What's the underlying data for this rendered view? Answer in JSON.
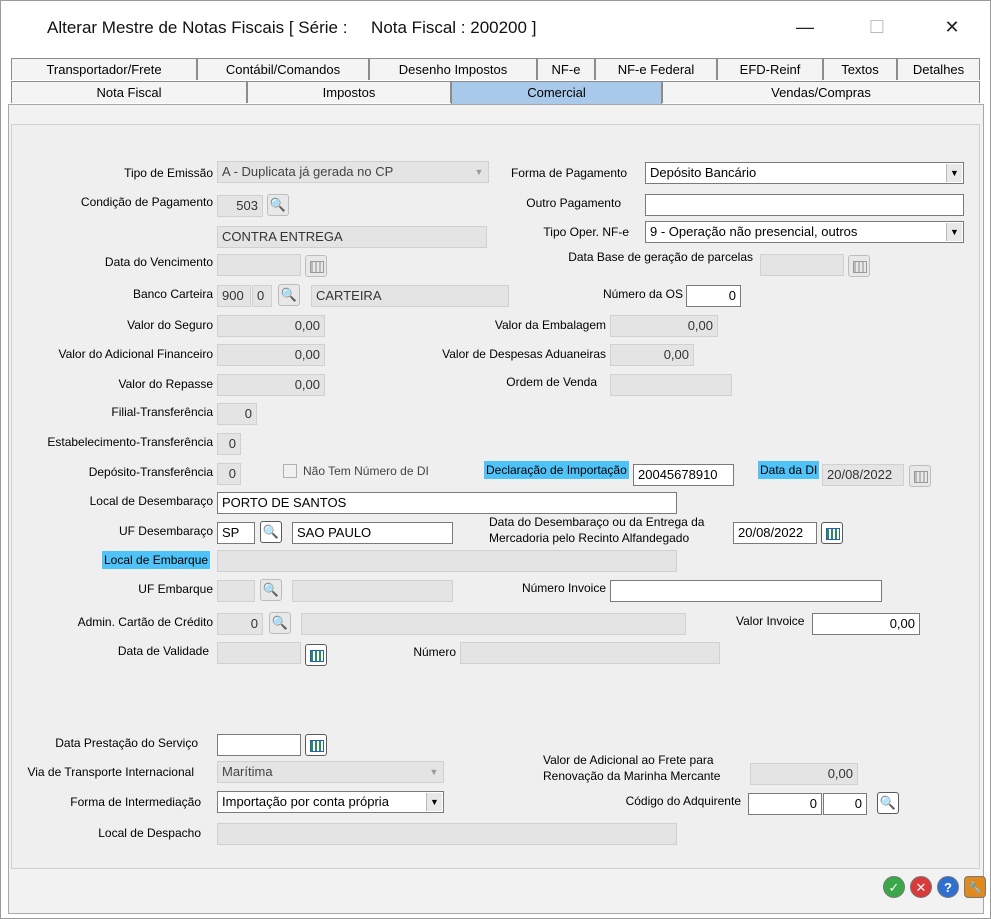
{
  "window": {
    "title": "Alterar Mestre de Notas Fiscais [ Série :     Nota Fiscal : 200200 ]",
    "minimize": "—",
    "maximize": "☐",
    "close": "✕"
  },
  "tabs_top": [
    "Transportador/Frete",
    "Contábil/Comandos",
    "Desenho Impostos",
    "NF-e",
    "NF-e Federal",
    "EFD-Reinf",
    "Textos",
    "Detalhes"
  ],
  "tabs_bottom": [
    "Nota Fiscal",
    "Impostos",
    "Comercial",
    "Vendas/Compras"
  ],
  "active_tab": "Comercial",
  "labels": {
    "tipo_emissao": "Tipo de Emissão",
    "forma_pagamento": "Forma de Pagamento",
    "condicao_pagamento": "Condição de Pagamento",
    "outro_pagamento": "Outro Pagamento",
    "tipo_oper": "Tipo Oper. NF-e",
    "data_vencimento": "Data do Vencimento",
    "data_base": "Data Base de geração de parcelas",
    "banco_carteira": "Banco Carteira",
    "numero_os": "Número da OS",
    "valor_seguro": "Valor do Seguro",
    "valor_embalagem": "Valor da Embalagem",
    "valor_adicional": "Valor do Adicional Financeiro",
    "valor_despesas": "Valor de Despesas Aduaneiras",
    "valor_repasse": "Valor do Repasse",
    "ordem_venda": "Ordem de Venda",
    "filial_transf": "Filial-Transferência",
    "estab_transf": "Estabelecimento-Transferência",
    "deposito_transf": "Depósito-Transferência",
    "nao_tem_di": "Não Tem Número de DI",
    "declaracao_importacao": "Declaração de Importação",
    "data_di": "Data da DI",
    "local_desembaraco": "Local de Desembaraço",
    "uf_desembaraco": "UF Desembaraço",
    "data_desembaraco_1": "Data do Desembaraço ou da Entrega da",
    "data_desembaraco_2": "Mercadoria pelo Recinto Alfandegado",
    "local_embarque": "Local de Embarque",
    "uf_embarque": "UF Embarque",
    "numero_invoice": "Número Invoice",
    "admin_cartao": "Admin. Cartão de Crédito",
    "valor_invoice": "Valor Invoice",
    "data_validade": "Data de Validade",
    "numero": "Número",
    "data_prestacao": "Data Prestação do Serviço",
    "via_transporte": "Via de Transporte Internacional",
    "valor_adicional_frete_1": "Valor de Adicional ao Frete para",
    "valor_adicional_frete_2": "Renovação da Marinha Mercante",
    "forma_intermediacao": "Forma de Intermediação",
    "codigo_adquirente": "Código do Adquirente",
    "local_despacho": "Local de Despacho"
  },
  "values": {
    "tipo_emissao": "A - Duplicata já gerada no CP",
    "forma_pagamento": "Depósito Bancário",
    "condicao_pagamento_code": "503",
    "condicao_pagamento_desc": "CONTRA ENTREGA",
    "outro_pagamento": "",
    "tipo_oper": "9 - Operação não presencial, outros",
    "data_vencimento": "",
    "data_base": "",
    "banco": "900",
    "carteira": "0",
    "carteira_desc": "CARTEIRA",
    "numero_os": "0",
    "valor_seguro": "0,00",
    "valor_embalagem": "0,00",
    "valor_adicional": "0,00",
    "valor_despesas": "0,00",
    "valor_repasse": "0,00",
    "ordem_venda": "",
    "filial_transf": "0",
    "estab_transf": "0",
    "deposito_transf": "0",
    "declaracao_importacao": "20045678910",
    "data_di": "20/08/2022",
    "local_desembaraco": "PORTO DE SANTOS",
    "uf_desembaraco": "SP",
    "uf_desembaraco_desc": "SAO PAULO",
    "data_desembaraco": "20/08/2022",
    "local_embarque": "",
    "uf_embarque": "",
    "numero_invoice": "",
    "admin_cartao": "0",
    "valor_invoice": "0,00",
    "data_validade": "",
    "numero": "",
    "data_prestacao": "",
    "via_transporte": "Marítima",
    "valor_adicional_frete": "0,00",
    "forma_intermediacao": "Importação por conta própria",
    "codigo_adquirente_1": "0",
    "codigo_adquirente_2": "0",
    "local_despacho": ""
  },
  "icons": {
    "search": "🔍",
    "ok": "✓",
    "cancel": "✕",
    "help": "?",
    "tools": "🔧"
  },
  "colors": {
    "active_tab": "#a9c9ea",
    "highlight": "#4fc3f7",
    "ok": "#3aa84a",
    "cancel": "#d93a3a",
    "help": "#2f6fd0",
    "tools": "#e08a1e"
  }
}
